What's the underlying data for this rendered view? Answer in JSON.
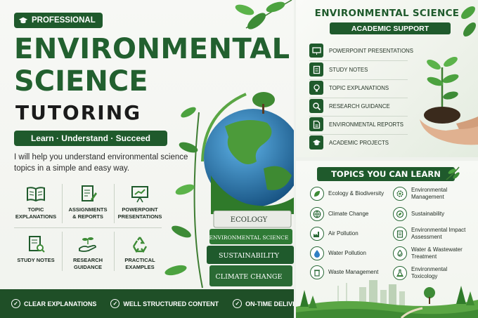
{
  "left": {
    "badge": "PROFESSIONAL",
    "title_line1": "ENVIRONMENTAL",
    "title_line2": "SCIENCE",
    "title_line3": "TUTORING",
    "tagline": "Learn · Understand · Succeed",
    "intro": "I will help you understand environmental science topics in a simple and easy way.",
    "services": [
      {
        "label": "TOPIC\nEXPLANATIONS",
        "icon": "open-book-icon"
      },
      {
        "label": "ASSIGNMENTS\n& REPORTS",
        "icon": "document-pen-icon"
      },
      {
        "label": "POWERPOINT\nPRESENTATIONS",
        "icon": "presentation-chart-icon"
      },
      {
        "label": "STUDY NOTES",
        "icon": "notes-magnifier-icon"
      },
      {
        "label": "RESEARCH\nGUIDANCE",
        "icon": "hand-plant-icon"
      },
      {
        "label": "PRACTICAL\nEXAMPLES",
        "icon": "recycle-icon"
      }
    ],
    "books": [
      "ECOLOGY",
      "ENVIRONMENTAL SCIENCE",
      "SUSTAINABILITY",
      "CLIMATE CHANGE"
    ],
    "features": [
      "CLEAR EXPLANATIONS",
      "WELL STRUCTURED CONTENT",
      "ON-TIME DELIVERY"
    ],
    "check_glyph": "✓"
  },
  "support": {
    "title": "ENVIRONMENTAL SCIENCE",
    "subtitle": "ACADEMIC SUPPORT",
    "items": [
      {
        "label": "POWERPOINT PRESENTATIONS",
        "icon": "presentation-icon"
      },
      {
        "label": "STUDY NOTES",
        "icon": "notes-icon"
      },
      {
        "label": "TOPIC EXPLANATIONS",
        "icon": "lightbulb-icon"
      },
      {
        "label": "RESEARCH GUIDANCE",
        "icon": "magnifier-icon"
      },
      {
        "label": "ENVIRONMENTAL REPORTS",
        "icon": "report-icon"
      },
      {
        "label": "ACADEMIC PROJECTS",
        "icon": "graduation-cap-icon"
      }
    ]
  },
  "topics": {
    "title": "TOPICS YOU CAN LEARN",
    "left_column": [
      {
        "label": "Ecology & Biodiversity",
        "icon": "leaf-icon"
      },
      {
        "label": "Climate Change",
        "icon": "globe-icon"
      },
      {
        "label": "Air Pollution",
        "icon": "factory-icon"
      },
      {
        "label": "Water Pollution",
        "icon": "water-drop-icon"
      },
      {
        "label": "Waste Management",
        "icon": "trash-bin-icon"
      }
    ],
    "right_column": [
      {
        "label": "Environmental\nManagement",
        "icon": "gear-leaf-icon"
      },
      {
        "label": "Sustainability",
        "icon": "recycle-leaf-icon"
      },
      {
        "label": "Environmental Impact\nAssessment",
        "icon": "clipboard-icon"
      },
      {
        "label": "Water & Wastewater\nTreatment",
        "icon": "water-treatment-icon"
      },
      {
        "label": "Environmental\nToxicology",
        "icon": "flask-icon"
      }
    ]
  },
  "colors": {
    "primary_green": "#1f5a2c",
    "title_green": "#22602f",
    "footer_green": "#1f4f27"
  }
}
